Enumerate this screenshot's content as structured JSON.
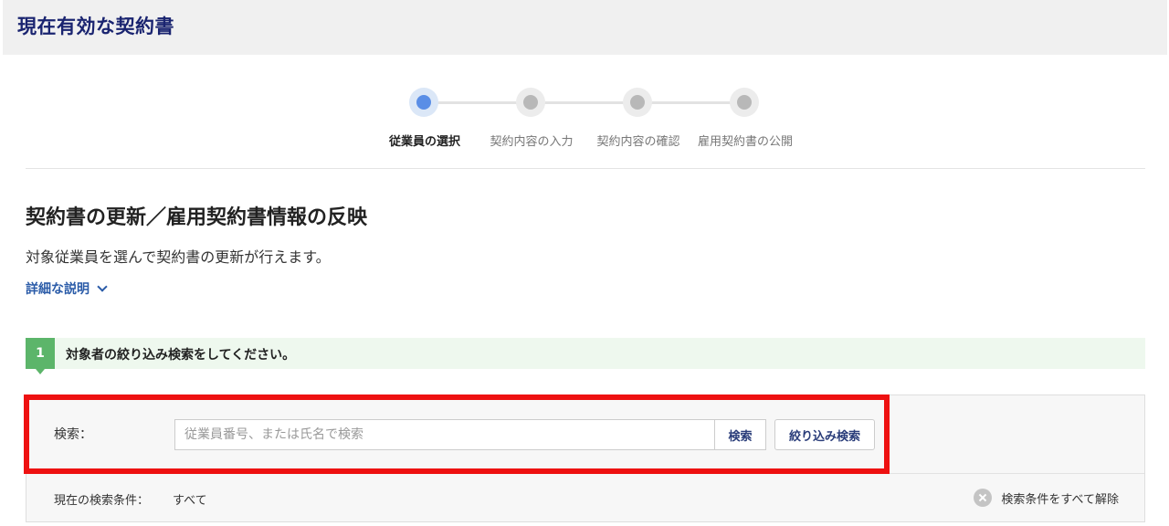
{
  "header": {
    "title": "現在有効な契約書"
  },
  "stepper": {
    "steps": [
      {
        "label": "従業員の選択",
        "active": true
      },
      {
        "label": "契約内容の入力",
        "active": false
      },
      {
        "label": "契約内容の確認",
        "active": false
      },
      {
        "label": "雇用契約書の公開",
        "active": false
      }
    ]
  },
  "section": {
    "title": "契約書の更新／雇用契約書情報の反映",
    "description": "対象従業員を選んで契約書の更新が行えます。",
    "detail_link": "詳細な説明"
  },
  "step_banner": {
    "number": "1",
    "text": "対象者の絞り込み検索をしてください。"
  },
  "search": {
    "label": "検索：",
    "placeholder": "従業員番号、または氏名で検索",
    "value": "",
    "search_button": "検索",
    "filter_button": "絞り込み検索",
    "current_conditions_label": "現在の検索条件：",
    "current_conditions_value": "すべて",
    "clear_all": "検索条件をすべて解除"
  },
  "colors": {
    "header_title": "#1a2470",
    "active_step": "#5a8ee6",
    "banner_badge": "#5cb56a",
    "highlight_frame": "#ee1111"
  }
}
